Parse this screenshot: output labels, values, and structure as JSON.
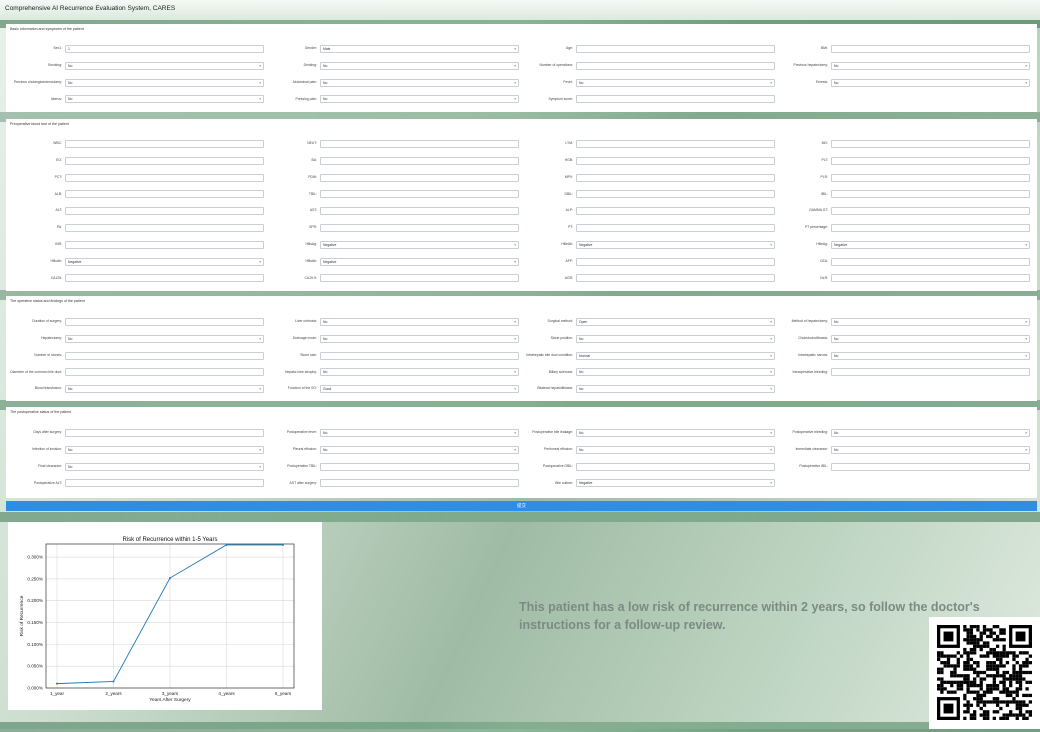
{
  "app": {
    "title": "Comprehensive AI Recurrence Evaluation System, CARES"
  },
  "sections": [
    {
      "title": "Basic information and symptoms of the patient",
      "fields": [
        {
          "label": "Sex1:",
          "value": "1",
          "type": "input"
        },
        {
          "label": "Gender:",
          "value": "Male",
          "type": "select"
        },
        {
          "label": "Age:",
          "value": "",
          "type": "input"
        },
        {
          "label": "BMI:",
          "value": "",
          "type": "input"
        },
        {
          "label": "Smoking:",
          "value": "No",
          "type": "select"
        },
        {
          "label": "Drinking:",
          "value": "No",
          "type": "select"
        },
        {
          "label": "Number of operations:",
          "value": "",
          "type": "input"
        },
        {
          "label": "Previous hepatectomy:",
          "value": "No",
          "type": "select"
        },
        {
          "label": "Previous cholangioenterostomy:",
          "value": "No",
          "type": "select"
        },
        {
          "label": "Abdominal pain:",
          "value": "No",
          "type": "select"
        },
        {
          "label": "Fever:",
          "value": "No",
          "type": "select"
        },
        {
          "label": "Emesis:",
          "value": "No",
          "type": "select"
        },
        {
          "label": "Icterus:",
          "value": "No",
          "type": "select"
        },
        {
          "label": "Pressing pain:",
          "value": "No",
          "type": "select"
        },
        {
          "label": "Symptom score:",
          "value": "",
          "type": "input"
        }
      ]
    },
    {
      "title": "Preoperative blood test of the patient",
      "fields": [
        {
          "label": "WBC:",
          "value": "",
          "type": "input"
        },
        {
          "label": "NEUT:",
          "value": "",
          "type": "input"
        },
        {
          "label": "LYM:",
          "value": "",
          "type": "input"
        },
        {
          "label": "MO:",
          "value": "",
          "type": "input"
        },
        {
          "label": "EO:",
          "value": "",
          "type": "input"
        },
        {
          "label": "BA:",
          "value": "",
          "type": "input"
        },
        {
          "label": "HGB:",
          "value": "",
          "type": "input"
        },
        {
          "label": "PLT:",
          "value": "",
          "type": "input"
        },
        {
          "label": "PCT:",
          "value": "",
          "type": "input"
        },
        {
          "label": "PDW:",
          "value": "",
          "type": "input"
        },
        {
          "label": "MPV:",
          "value": "",
          "type": "input"
        },
        {
          "label": "PLR:",
          "value": "",
          "type": "input"
        },
        {
          "label": "ALB:",
          "value": "",
          "type": "input"
        },
        {
          "label": "TBIL:",
          "value": "",
          "type": "input"
        },
        {
          "label": "DBIL:",
          "value": "",
          "type": "input"
        },
        {
          "label": "IBIL:",
          "value": "",
          "type": "input"
        },
        {
          "label": "ALT:",
          "value": "",
          "type": "input"
        },
        {
          "label": "AST:",
          "value": "",
          "type": "input"
        },
        {
          "label": "ALP:",
          "value": "",
          "type": "input"
        },
        {
          "label": "GAMMA GT:",
          "value": "",
          "type": "input"
        },
        {
          "label": "PA:",
          "value": "",
          "type": "input"
        },
        {
          "label": "SPR:",
          "value": "",
          "type": "input"
        },
        {
          "label": "PT:",
          "value": "",
          "type": "input"
        },
        {
          "label": "PT percentage:",
          "value": "",
          "type": "input"
        },
        {
          "label": "INR:",
          "value": "",
          "type": "input"
        },
        {
          "label": "HBsAg:",
          "value": "Negative",
          "type": "select"
        },
        {
          "label": "HBeAb:",
          "value": "Negative",
          "type": "select"
        },
        {
          "label": "HBeAg:",
          "value": "Negative",
          "type": "select"
        },
        {
          "label": "HBcAb:",
          "value": "Negative",
          "type": "select"
        },
        {
          "label": "HBsAb:",
          "value": "Negative",
          "type": "select"
        },
        {
          "label": "AFP:",
          "value": "",
          "type": "input"
        },
        {
          "label": "CEA:",
          "value": "",
          "type": "input"
        },
        {
          "label": "CA125:",
          "value": "",
          "type": "input"
        },
        {
          "label": "CA19-9:",
          "value": "",
          "type": "input"
        },
        {
          "label": "AGR:",
          "value": "",
          "type": "input"
        },
        {
          "label": "NLR:",
          "value": "",
          "type": "input"
        }
      ]
    },
    {
      "title": "The operative status and findings of the patient",
      "fields": [
        {
          "label": "Duration of surgery:",
          "value": "",
          "type": "input"
        },
        {
          "label": "Liver cirrhosis:",
          "value": "No",
          "type": "select"
        },
        {
          "label": "Surgical method:",
          "value": "Open",
          "type": "select"
        },
        {
          "label": "Method of hepatectomy:",
          "value": "No",
          "type": "select"
        },
        {
          "label": "Hepatectomy:",
          "value": "No",
          "type": "select"
        },
        {
          "label": "Drainage mode:",
          "value": "No",
          "type": "select"
        },
        {
          "label": "Stone position:",
          "value": "No",
          "type": "select"
        },
        {
          "label": "Choledochofibrasis:",
          "value": "No",
          "type": "select"
        },
        {
          "label": "Number of stones:",
          "value": "",
          "type": "input"
        },
        {
          "label": "Stone size:",
          "value": "",
          "type": "input"
        },
        {
          "label": "Intrahepatic bile duct condition:",
          "value": "Normal",
          "type": "select"
        },
        {
          "label": "Intrahepatic narrow:",
          "value": "No",
          "type": "select"
        },
        {
          "label": "Diameter of the common bile duct:",
          "value": "",
          "type": "input"
        },
        {
          "label": "Hepatic lobe atrophy:",
          "value": "No",
          "type": "select"
        },
        {
          "label": "Biliary sclerosis:",
          "value": "No",
          "type": "select"
        },
        {
          "label": "Intraoperative bleeding:",
          "value": "",
          "type": "input"
        },
        {
          "label": "Blood transfusion:",
          "value": "No",
          "type": "select"
        },
        {
          "label": "Function of the SO:",
          "value": "Good",
          "type": "select"
        },
        {
          "label": "Bilateral hepatolithiasis:",
          "value": "No",
          "type": "select"
        }
      ]
    },
    {
      "title": "The postoperative status of the patient",
      "fields": [
        {
          "label": "Days after surgery:",
          "value": "",
          "type": "input"
        },
        {
          "label": "Postoperative fever:",
          "value": "No",
          "type": "select"
        },
        {
          "label": "Postoperative bile leakage:",
          "value": "No",
          "type": "select"
        },
        {
          "label": "Postoperative bleeding:",
          "value": "No",
          "type": "select"
        },
        {
          "label": "Infection of incision:",
          "value": "No",
          "type": "select"
        },
        {
          "label": "Pleural effusion:",
          "value": "No",
          "type": "select"
        },
        {
          "label": "Peritoneal effusion:",
          "value": "No",
          "type": "select"
        },
        {
          "label": "Immediate clearance:",
          "value": "No",
          "type": "select"
        },
        {
          "label": "Final clearance:",
          "value": "No",
          "type": "select"
        },
        {
          "label": "Postoperative TBIL:",
          "value": "",
          "type": "input"
        },
        {
          "label": "Postoperative DBIL:",
          "value": "",
          "type": "input"
        },
        {
          "label": "Postoperative IBIL:",
          "value": "",
          "type": "input"
        },
        {
          "label": "Postoperative ALT:",
          "value": "",
          "type": "input"
        },
        {
          "label": "AST after surgery:",
          "value": "",
          "type": "input"
        },
        {
          "label": "Bile culture:",
          "value": "Negative",
          "type": "select"
        }
      ]
    }
  ],
  "submit": {
    "label": "提交"
  },
  "result": {
    "text": "This patient has a low risk of recurrence within 2 years, so follow the doctor's instructions for a follow-up review."
  },
  "chart_data": {
    "type": "line",
    "title": "Risk of Recurrence within 1-5 Years",
    "xlabel": "Years After Surgery",
    "ylabel": "Risk of Recurrence",
    "categories": [
      "1_year",
      "2_years",
      "3_years",
      "4_years",
      "5_years"
    ],
    "values": [
      0.0001,
      0.00015,
      0.00252,
      0.00328,
      0.00328
    ],
    "yticks": [
      "0.000%",
      "0.050%",
      "0.100%",
      "0.150%",
      "0.200%",
      "0.250%",
      "0.300%"
    ],
    "ylim": [
      0,
      0.0033
    ],
    "grid": true,
    "color": "#1f77b4"
  }
}
